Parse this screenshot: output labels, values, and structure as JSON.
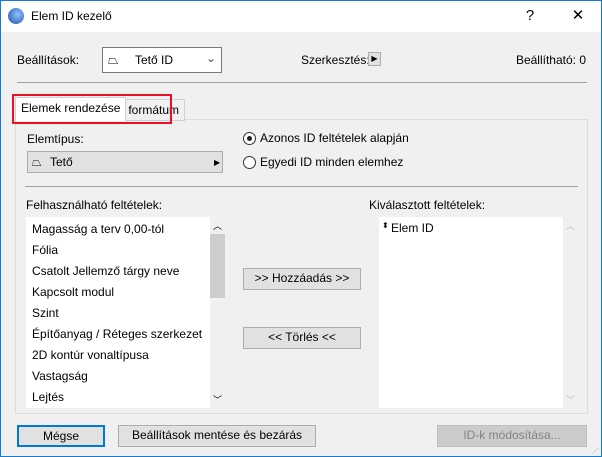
{
  "window": {
    "title": "Elem ID kezelő",
    "help": "?",
    "close": "✕"
  },
  "top": {
    "settings_label": "Beállítások:",
    "settings_value": "Tető ID",
    "edit_label": "Szerkesztés:",
    "settable": "Beállítható: 0"
  },
  "tabs": [
    {
      "label": "Elemek rendezése"
    },
    {
      "label": "ID formátum"
    }
  ],
  "element_type": {
    "label": "Elemtípus:",
    "value": "Tető"
  },
  "radios": [
    {
      "label": "Azonos ID feltételek alapján",
      "checked": true
    },
    {
      "label": "Egyedi ID minden elemhez",
      "checked": false
    }
  ],
  "available": {
    "label": "Felhasználható feltételek:",
    "items": [
      "Magasság a terv 0,00-tól",
      "Fólia",
      "Csatolt Jellemző tárgy neve",
      "Kapcsolt modul",
      "Szint",
      "Építőanyag / Réteges szerkezet",
      "2D kontúr vonaltípusa",
      "Vastagság",
      "Lejtés"
    ]
  },
  "selected": {
    "label": "Kiválasztott feltételek:",
    "items": [
      "Elem ID"
    ]
  },
  "buttons": {
    "add": ">> Hozzáadás >>",
    "remove": "<< Törlés <<",
    "cancel": "Mégse",
    "save": "Beállítások mentése és bezárás",
    "modify": "ID-k módosítása..."
  },
  "colors": {
    "accent": "#1979ca",
    "highlight": "#e81123"
  }
}
